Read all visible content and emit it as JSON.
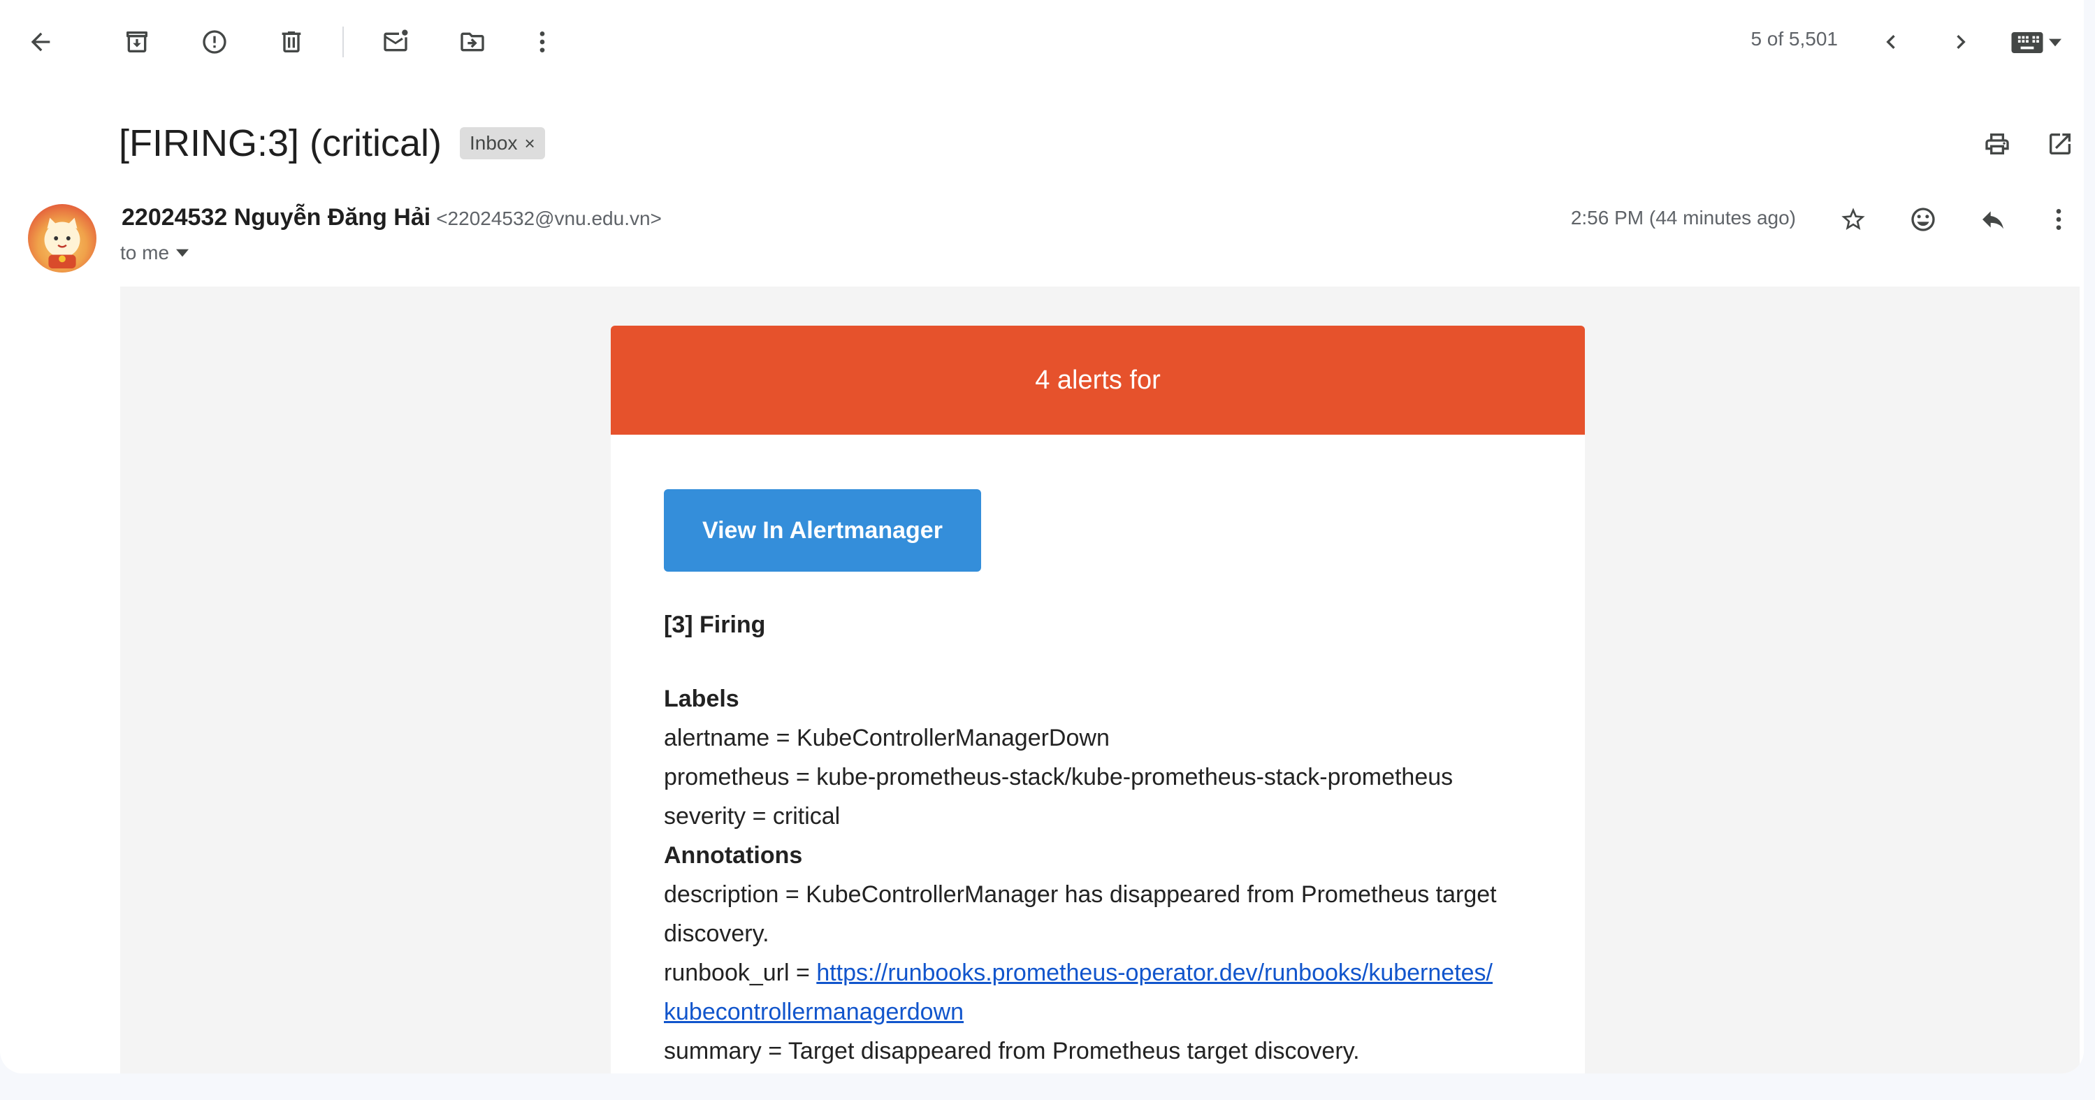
{
  "toolbar": {
    "icons": [
      "back-arrow-icon",
      "archive-icon",
      "report-spam-icon",
      "delete-icon",
      "mark-unread-icon",
      "move-to-icon",
      "more-vert-icon"
    ],
    "pager_text": "5 of 5,501"
  },
  "subject": {
    "title": "[FIRING:3] (critical)",
    "label_chip": "Inbox",
    "chip_close": "×"
  },
  "sender": {
    "name": "22024532 Nguyễn Đăng Hải",
    "email": "<22024532@vnu.edu.vn>",
    "to_text": "to me",
    "time": "2:56 PM (44 minutes ago)"
  },
  "email": {
    "header_text": "4 alerts for",
    "button_label": "View In Alertmanager",
    "firing_heading": "[3] Firing",
    "labels_heading": "Labels",
    "labels": [
      "alertname = KubeControllerManagerDown",
      "prometheus = kube-prometheus-stack/kube-prometheus-stack-prometheus",
      "severity = critical"
    ],
    "annotations_heading": "Annotations",
    "description_line1": "description = KubeControllerManager has disappeared from Prometheus target",
    "description_line2": "discovery.",
    "runbook_prefix": "runbook_url = ",
    "runbook_url_line1": "https://runbooks.prometheus-operator.dev/runbooks/kubernetes/",
    "runbook_url_line2": "kubecontrollermanagerdown",
    "summary": "summary = Target disappeared from Prometheus target discovery."
  },
  "colors": {
    "alert_header": "#e6522c",
    "button": "#348eda",
    "link": "#1155cc"
  }
}
